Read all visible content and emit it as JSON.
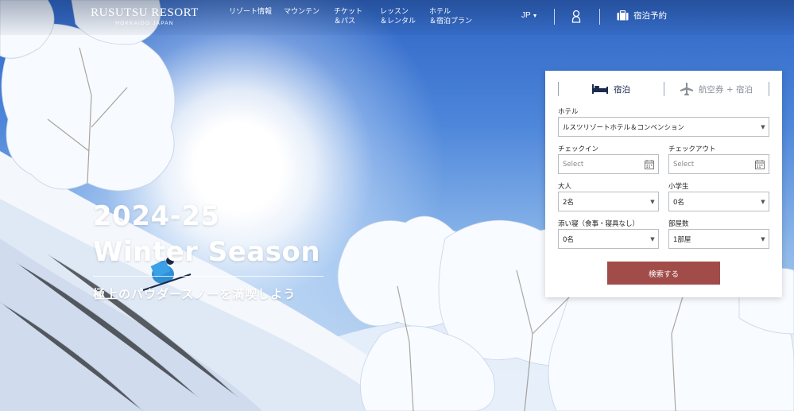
{
  "brand": {
    "logo_main": "RUSUTSU RESORT",
    "logo_sub": "HOKKAIDO JAPAN"
  },
  "nav": {
    "items": [
      {
        "label": "リゾート情報"
      },
      {
        "label": "マウンテン"
      },
      {
        "label": "チケット\n＆パス"
      },
      {
        "label": "レッスン\n＆レンタル"
      },
      {
        "label": "ホテル\n＆宿泊プラン"
      }
    ],
    "language": "JP",
    "booking_label": "宿泊予約"
  },
  "hero": {
    "season_line1": "2024-25",
    "season_line2": "Winter Season",
    "tagline": "極上のパウダースノーを満喫しよう"
  },
  "booking": {
    "tabs": [
      {
        "label": "宿泊",
        "icon": "bed-icon",
        "active": true
      },
      {
        "label": "航空券 + 宿泊",
        "icon": "airplane-icon",
        "active": false
      }
    ],
    "hotel": {
      "label": "ホテル",
      "value": "ルスツリゾートホテル＆コンベンション"
    },
    "checkin": {
      "label": "チェックイン",
      "placeholder": "Select"
    },
    "checkout": {
      "label": "チェックアウト",
      "placeholder": "Select"
    },
    "adults": {
      "label": "大人",
      "value": "2名"
    },
    "children": {
      "label": "小学生",
      "value": "0名"
    },
    "cosleeping": {
      "label": "添い寝（食事・寝具なし）",
      "value": "0名"
    },
    "rooms": {
      "label": "部屋数",
      "value": "1部屋"
    },
    "search_label": "検索する"
  },
  "colors": {
    "search_button": "#a14c49",
    "active_tab_text": "#1c2a4d",
    "inactive_tab_text": "#8a8f99"
  }
}
